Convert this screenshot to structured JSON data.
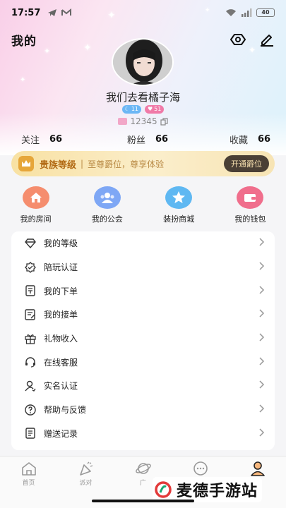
{
  "status_bar": {
    "time": "17:57",
    "battery": "40"
  },
  "header": {
    "title": "我的"
  },
  "profile": {
    "nickname": "我们去看橘子海",
    "badge_a": "11",
    "badge_b": "51",
    "uid": "12345"
  },
  "stats": [
    {
      "label": "关注",
      "value": "66"
    },
    {
      "label": "粉丝",
      "value": "66"
    },
    {
      "label": "收藏",
      "value": "66"
    }
  ],
  "vip": {
    "title": "贵族等级",
    "separator": "|",
    "desc": "至尊爵位，尊享体验",
    "button": "开通爵位"
  },
  "quick": [
    {
      "label": "我的房间",
      "icon": "home-icon",
      "color": "#f58d6e"
    },
    {
      "label": "我的公会",
      "icon": "group-icon",
      "color": "#7ea7f5"
    },
    {
      "label": "装扮商城",
      "icon": "star-icon",
      "color": "#5fb8f2"
    },
    {
      "label": "我的钱包",
      "icon": "wallet-icon",
      "color": "#f06e8c"
    }
  ],
  "menu": [
    {
      "label": "我的等级",
      "icon": "diamond-icon"
    },
    {
      "label": "陪玩认证",
      "icon": "badge-icon"
    },
    {
      "label": "我的下单",
      "icon": "order-icon"
    },
    {
      "label": "我的接单",
      "icon": "receive-order-icon"
    },
    {
      "label": "礼物收入",
      "icon": "gift-icon"
    },
    {
      "label": "在线客服",
      "icon": "headset-icon"
    },
    {
      "label": "实名认证",
      "icon": "person-verify-icon"
    },
    {
      "label": "帮助与反馈",
      "icon": "help-icon"
    },
    {
      "label": "赠送记录",
      "icon": "record-icon"
    }
  ],
  "tabs": [
    {
      "label": "首页",
      "icon": "home-tab-icon"
    },
    {
      "label": "派对",
      "icon": "party-icon"
    },
    {
      "label": "广",
      "icon": "planet-icon"
    },
    {
      "label": "",
      "icon": "chat-icon"
    },
    {
      "label": "",
      "icon": "profile-icon"
    }
  ],
  "watermark": {
    "text": "麦德手游站"
  }
}
